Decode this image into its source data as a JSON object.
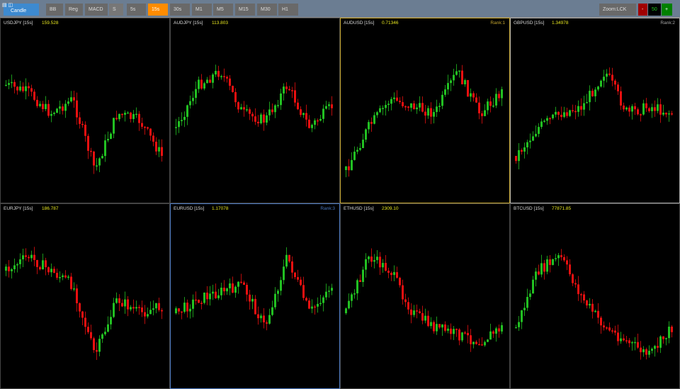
{
  "toolbar": {
    "chart_type": "Candle",
    "indicators": [
      "BB",
      "Reg",
      "MACD"
    ],
    "s_label": "S",
    "timeframes": [
      "5s",
      "15s",
      "30s",
      "M1",
      "M5",
      "M15",
      "M30",
      "H1"
    ],
    "active_timeframe": "15s",
    "zoom_label": "Zoom:LCK",
    "zoom_minus": "-",
    "zoom_value": "50",
    "zoom_plus": "+"
  },
  "colors": {
    "up": "#22c022",
    "down": "#e81010",
    "price": "#e8e820",
    "rank1": "#c8a830",
    "rank2": "#aaaaaa",
    "rank3": "#4a78c0"
  },
  "panels": [
    {
      "symbol": "USDJPY [15s]",
      "price": "159.528",
      "rank": ""
    },
    {
      "symbol": "AUDJPY [15s]",
      "price": "113.803",
      "rank": ""
    },
    {
      "symbol": "AUDUSD [15s]",
      "price": "0.71346",
      "rank": "Rank:1"
    },
    {
      "symbol": "GBPUSD [15s]",
      "price": "1.34978",
      "rank": "Rank:2"
    },
    {
      "symbol": "EURJPY [15s]",
      "price": "186.787",
      "rank": ""
    },
    {
      "symbol": "EURUSD [15s]",
      "price": "1.17078",
      "rank": "Rank:3"
    },
    {
      "symbol": "ETHUSD [15s]",
      "price": "2309.10",
      "rank": ""
    },
    {
      "symbol": "BTCUSD [15s]",
      "price": "77871.85",
      "rank": ""
    }
  ]
}
